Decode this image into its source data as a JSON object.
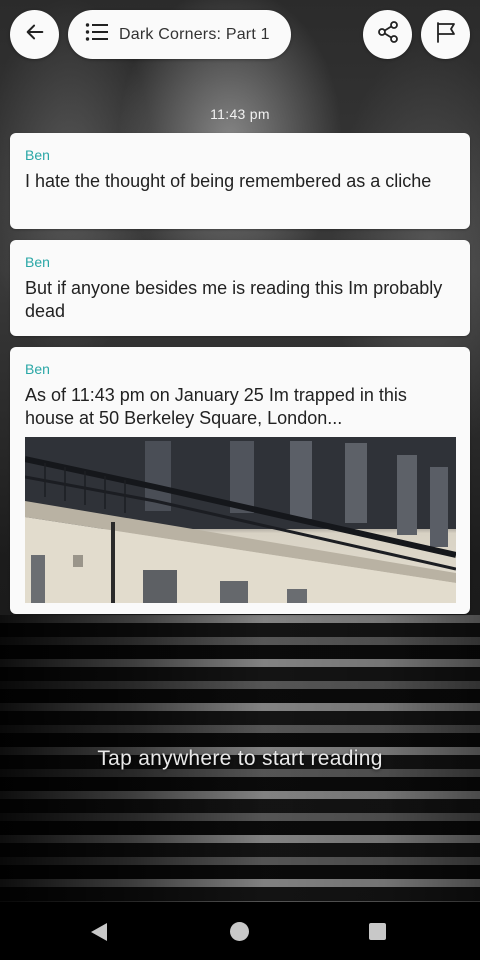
{
  "header": {
    "story_title": "Dark Corners: Part 1",
    "back_icon": "arrow-left-icon",
    "list_icon": "list-icon",
    "share_icon": "share-icon",
    "flag_icon": "flag-icon"
  },
  "timestamp": "11:43 pm",
  "messages": [
    {
      "sender": "Ben",
      "text": "I hate the thought of being remembered as a cliche"
    },
    {
      "sender": "Ben",
      "text": "But if anyone besides me is reading this Im probably dead"
    },
    {
      "sender": "Ben",
      "text": "As of 11:43 pm on January 25 Im trapped in this house at 50 Berkeley Square, London...",
      "has_photo": true
    }
  ],
  "hint": "Tap anywhere to start reading",
  "navigation_bar": {
    "back_icon": "nav-back-icon",
    "home_icon": "nav-home-icon",
    "recents_icon": "nav-recents-icon"
  },
  "colors": {
    "sender": "#2aa7a6",
    "card": "#fafafa",
    "hint": "#e9e9e9"
  }
}
